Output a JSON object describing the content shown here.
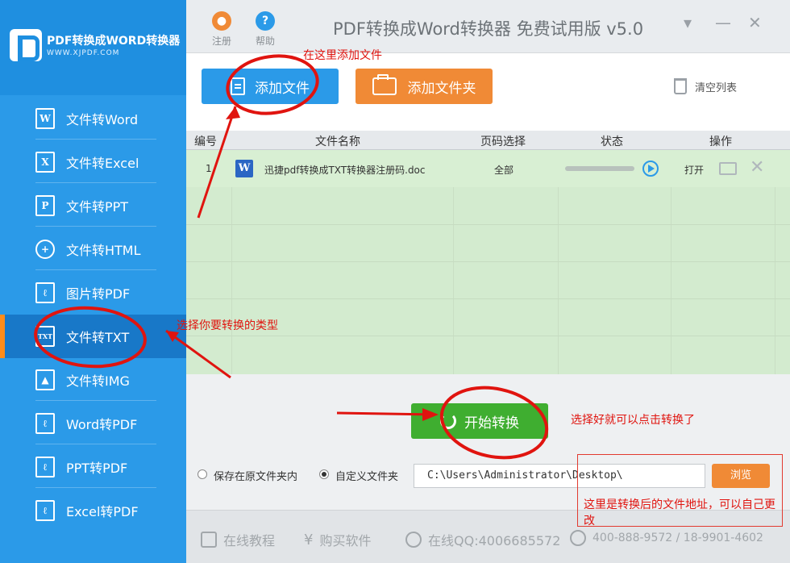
{
  "sidebar": {
    "logo_title": "PDF转换成WORD转换器",
    "logo_url": "WWW.XJPDF.COM",
    "items": [
      {
        "label": "文件转Word",
        "icon": "W"
      },
      {
        "label": "文件转Excel",
        "icon": "X"
      },
      {
        "label": "文件转PPT",
        "icon": "P"
      },
      {
        "label": "文件转HTML",
        "icon": "globe"
      },
      {
        "label": "图片转PDF",
        "icon": "pdf"
      },
      {
        "label": "文件转TXT",
        "icon": "TXT",
        "active": true
      },
      {
        "label": "文件转IMG",
        "icon": "img"
      },
      {
        "label": "Word转PDF",
        "icon": "pdf"
      },
      {
        "label": "PPT转PDF",
        "icon": "pdf"
      },
      {
        "label": "Excel转PDF",
        "icon": "pdf"
      }
    ]
  },
  "topbar": {
    "register_label": "注册",
    "help_label": "帮助",
    "title": "PDF转换成Word转换器 免费试用版 v5.0",
    "minimize": "▾",
    "restore": "—",
    "close": "✕"
  },
  "toolbar": {
    "add_file": "添加文件",
    "add_folder": "添加文件夹",
    "clear_list": "清空列表"
  },
  "table": {
    "columns": [
      "编号",
      "文件名称",
      "页码选择",
      "状态",
      "操作"
    ],
    "rows": [
      {
        "index": "1",
        "filename": "迅捷pdf转换成TXT转换器注册码.doc",
        "pages": "全部",
        "progress": 0,
        "action_open": "打开"
      }
    ]
  },
  "convert": {
    "start_label": "开始转换",
    "save_original": "保存在原文件夹内",
    "save_custom": "自定义文件夹",
    "selected": "custom",
    "output_path": "C:\\Users\\Administrator\\Desktop\\",
    "browse_label": "浏览"
  },
  "footer": {
    "tutorial": "在线教程",
    "buy": "购买软件",
    "qq": "在线QQ:4006685572",
    "phone": "400-888-9572 / 18-9901-4602"
  },
  "annotations": {
    "add_here": "在这里添加文件",
    "choose_type": "选择你要转换的类型",
    "click_convert": "选择好就可以点击转换了",
    "change_path": "这里是转换后的文件地址，可以自己更改"
  },
  "colors": {
    "sidebar": "#2b9ae8",
    "accent_orange": "#f08a36",
    "start_green": "#3fae30",
    "annotation_red": "#e0140f"
  }
}
